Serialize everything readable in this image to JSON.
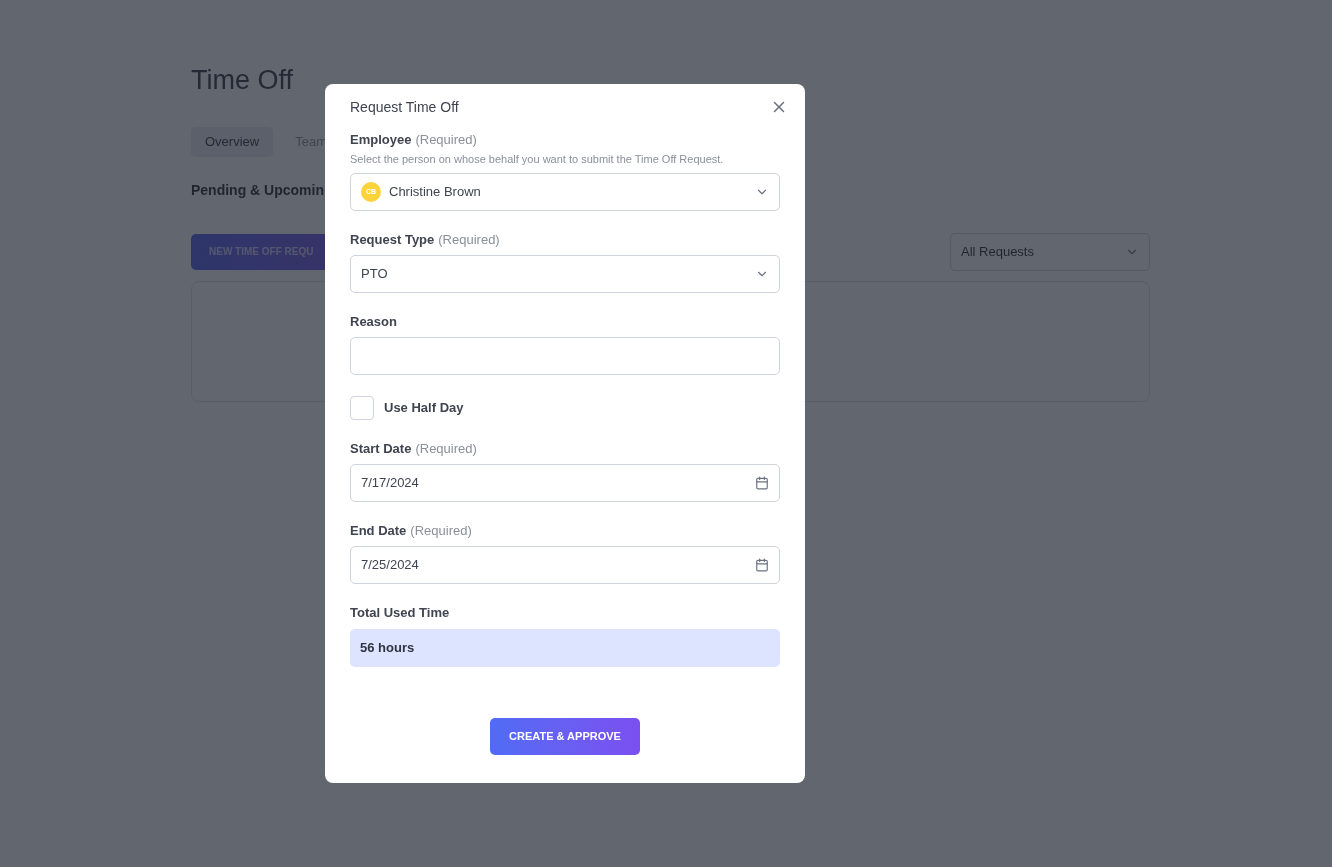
{
  "page": {
    "title": "Time Off",
    "tabs": [
      {
        "label": "Overview",
        "selected": true
      },
      {
        "label": "Team",
        "selected": false
      }
    ],
    "section_heading": "Pending & Upcomin",
    "new_button": "NEW TIME OFF REQU",
    "filter": {
      "value": "All Requests"
    }
  },
  "modal": {
    "title": "Request Time Off",
    "fields": [
      {
        "kind": "select",
        "label": "Employee",
        "required_note": "(Required)",
        "hint": "Select the person on whose behalf you want to submit the Time Off Request.",
        "avatar": "CB",
        "value": "Christine Brown"
      },
      {
        "kind": "select",
        "label": "Request Type",
        "required_note": "(Required)",
        "value": "PTO"
      },
      {
        "kind": "text",
        "label": "Reason"
      },
      {
        "kind": "checkbox",
        "label": "Use Half Day",
        "checked": false
      },
      {
        "kind": "date",
        "label": "Start Date",
        "required_note": "(Required)",
        "value": "7/17/2024"
      },
      {
        "kind": "date",
        "label": "End Date",
        "required_note": "(Required)",
        "value": "7/25/2024"
      },
      {
        "kind": "total",
        "label": "Total Used Time",
        "value": "56 hours"
      }
    ],
    "submit": "CREATE & APPROVE"
  }
}
